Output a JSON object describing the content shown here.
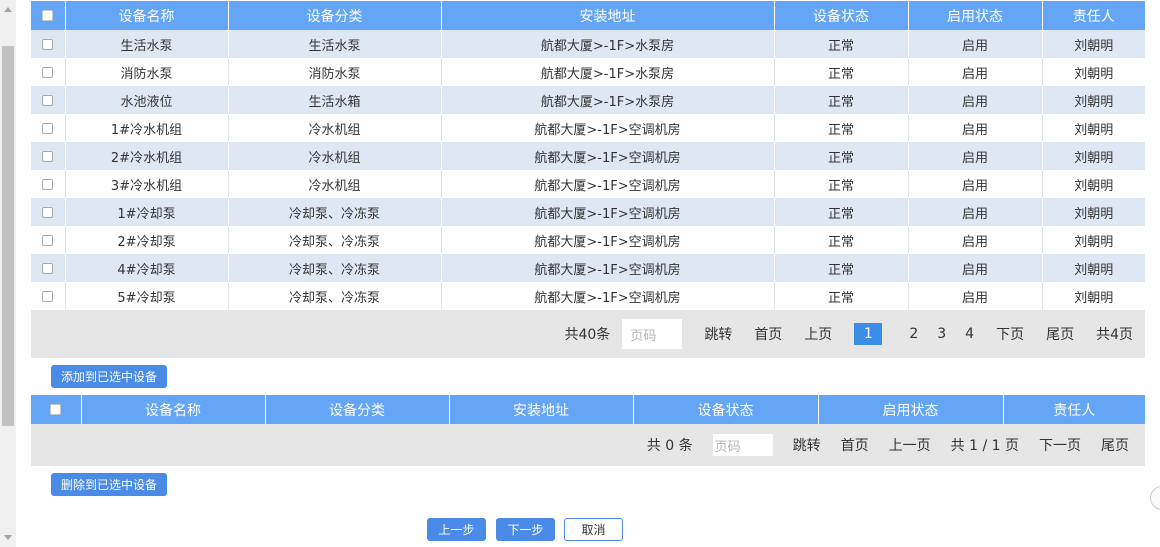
{
  "table1": {
    "headers": [
      "设备名称",
      "设备分类",
      "安装地址",
      "设备状态",
      "启用状态",
      "责任人"
    ],
    "rows": [
      [
        "生活水泵",
        "生活水泵",
        "航都大厦>-1F>水泵房",
        "正常",
        "启用",
        "刘朝明"
      ],
      [
        "消防水泵",
        "消防水泵",
        "航都大厦>-1F>水泵房",
        "正常",
        "启用",
        "刘朝明"
      ],
      [
        "水池液位",
        "生活水箱",
        "航都大厦>-1F>水泵房",
        "正常",
        "启用",
        "刘朝明"
      ],
      [
        "1#冷水机组",
        "冷水机组",
        "航都大厦>-1F>空调机房",
        "正常",
        "启用",
        "刘朝明"
      ],
      [
        "2#冷水机组",
        "冷水机组",
        "航都大厦>-1F>空调机房",
        "正常",
        "启用",
        "刘朝明"
      ],
      [
        "3#冷水机组",
        "冷水机组",
        "航都大厦>-1F>空调机房",
        "正常",
        "启用",
        "刘朝明"
      ],
      [
        "1#冷却泵",
        "冷却泵、冷冻泵",
        "航都大厦>-1F>空调机房",
        "正常",
        "启用",
        "刘朝明"
      ],
      [
        "2#冷却泵",
        "冷却泵、冷冻泵",
        "航都大厦>-1F>空调机房",
        "正常",
        "启用",
        "刘朝明"
      ],
      [
        "4#冷却泵",
        "冷却泵、冷冻泵",
        "航都大厦>-1F>空调机房",
        "正常",
        "启用",
        "刘朝明"
      ],
      [
        "5#冷却泵",
        "冷却泵、冷冻泵",
        "航都大厦>-1F>空调机房",
        "正常",
        "启用",
        "刘朝明"
      ]
    ]
  },
  "pager1": {
    "total": "共40条",
    "page_placeholder": "页码",
    "jump": "跳转",
    "first": "首页",
    "prev": "上页",
    "pages": [
      "1",
      "2",
      "3",
      "4"
    ],
    "next": "下页",
    "last": "尾页",
    "total_pages": "共4页"
  },
  "add_button": "添加到已选中设备",
  "table2": {
    "headers": [
      "设备名称",
      "设备分类",
      "安装地址",
      "设备状态",
      "启用状态",
      "责任人"
    ]
  },
  "pager2": {
    "total": "共 0 条",
    "page_placeholder": "页码",
    "jump": "跳转",
    "first": "首页",
    "prev": "上一页",
    "page_info": "共 1 / 1 页",
    "next": "下一页",
    "last": "尾页"
  },
  "delete_button": "删除到已选中设备",
  "footer": {
    "prev_step": "上一步",
    "next_step": "下一步",
    "cancel": "取消"
  },
  "colors": {
    "header_blue": "#64a5f5",
    "row_alt": "#dee8f5",
    "button_blue": "#4a8be8"
  }
}
